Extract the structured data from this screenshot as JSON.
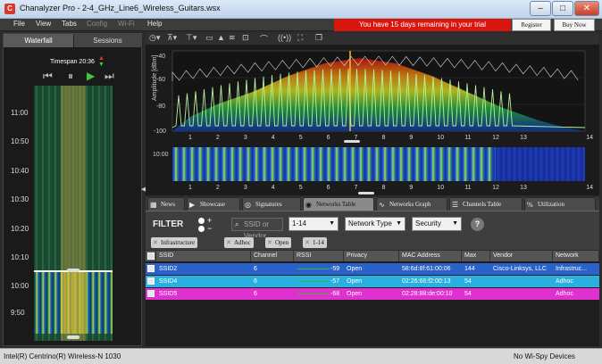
{
  "window": {
    "title": "Chanalyzer Pro - 2-4_GHz_Line6_Wireless_Guitars.wsx",
    "app_icon": "C"
  },
  "menu": [
    "File",
    "View",
    "Tabs",
    "Config",
    "Wi-Fi",
    "Help"
  ],
  "menu_disabled": [
    "Config",
    "Wi-Fi"
  ],
  "trial": {
    "banner": "You have 15 days remaining in your trial",
    "register": "Register",
    "buy": "Buy Now"
  },
  "left_panel": {
    "tabs": [
      "Waterfall",
      "Sessions"
    ],
    "timespan": "Timespan 20:36",
    "times": [
      "11:00",
      "10:50",
      "10:40",
      "10:30",
      "10:20",
      "10:10",
      "10:00",
      "9:50"
    ]
  },
  "graph": {
    "ylabel": "Amplitude [dBm]",
    "yticks": [
      "-40",
      "-60",
      "-80",
      "-100"
    ],
    "channels": [
      "1",
      "2",
      "3",
      "4",
      "5",
      "6",
      "7",
      "8",
      "9",
      "10",
      "11",
      "12",
      "13",
      "14"
    ],
    "waterfall_time": "10:00"
  },
  "tabs": [
    {
      "label": "News",
      "icon": "▦"
    },
    {
      "label": "Showcase",
      "icon": "▶"
    },
    {
      "label": "Signatures",
      "icon": "◎"
    },
    {
      "label": "Networks Table",
      "icon": "◉"
    },
    {
      "label": "Networks Graph",
      "icon": "∿"
    },
    {
      "label": "Channels Table",
      "icon": "☰"
    },
    {
      "label": "Utilization",
      "icon": "%"
    }
  ],
  "filter": {
    "label": "FILTER",
    "search_placeholder": "SSID or Vendor",
    "channel_range": "1-14",
    "network_type": "Network Type",
    "security": "Security",
    "help": "?"
  },
  "chips": [
    "Infrastructure",
    "Adhoc",
    "Open",
    "1-14"
  ],
  "table": {
    "columns": [
      "SSID",
      "Channel",
      "RSSI",
      "Privacy",
      "MAC Address",
      "Max",
      "Vendor",
      "Network"
    ],
    "rows": [
      {
        "ssid": "SSID2",
        "channel": "6",
        "rssi": "-59",
        "privacy": "Open",
        "mac": "58:6d:8f:61:00:06",
        "max": "144",
        "vendor": "Cisco-Linksys, LLC",
        "network": "Infrastruc...",
        "color": "#2a62c9"
      },
      {
        "ssid": "SSID4",
        "channel": "6",
        "rssi": "-57",
        "privacy": "Open",
        "mac": "02:26:66:f2:00:13",
        "max": "54",
        "vendor": "",
        "network": "Adhoc",
        "color": "#2ab0e0"
      },
      {
        "ssid": "SSID5",
        "channel": "6",
        "rssi": "-68",
        "privacy": "Open",
        "mac": "02:28:88:de:00:10",
        "max": "54",
        "vendor": "",
        "network": "Adhoc",
        "color": "#e030d0"
      }
    ]
  },
  "status": {
    "left": "Intel(R) Centrino(R) Wireless-N 1030",
    "right": "No Wi-Spy Devices"
  },
  "colors": {
    "banner": "#d9160d",
    "play": "#3cc93c",
    "trace": "#f0f0f0"
  }
}
